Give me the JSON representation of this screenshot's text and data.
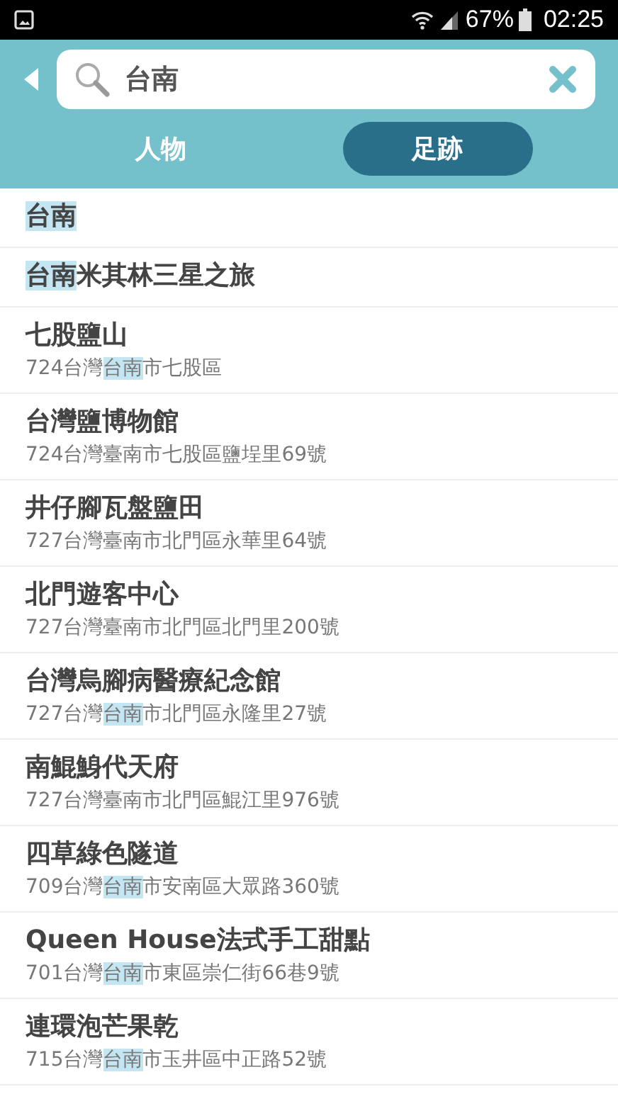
{
  "status_bar": {
    "battery": "67%",
    "time": "02:25"
  },
  "search": {
    "value": "台南"
  },
  "tabs": [
    {
      "label": "人物",
      "selected": false
    },
    {
      "label": "足跡",
      "selected": true
    }
  ],
  "results": [
    {
      "name": [
        {
          "text": "台南",
          "highlighted": true
        }
      ]
    },
    {
      "name": [
        {
          "text": "台南",
          "highlighted": true
        },
        {
          "text": "米其林三星之旅",
          "highlighted": false
        }
      ]
    },
    {
      "name": [
        {
          "text": "七股鹽山",
          "highlighted": false
        }
      ],
      "address": [
        {
          "text": "724台灣",
          "highlighted": false
        },
        {
          "text": "台南",
          "highlighted": true
        },
        {
          "text": "市七股區",
          "highlighted": false
        }
      ]
    },
    {
      "name": [
        {
          "text": "台灣鹽博物館",
          "highlighted": false
        }
      ],
      "address": [
        {
          "text": "724台灣臺南市七股區鹽埕里69號",
          "highlighted": false
        }
      ]
    },
    {
      "name": [
        {
          "text": "井仔腳瓦盤鹽田",
          "highlighted": false
        }
      ],
      "address": [
        {
          "text": "727台灣臺南市北門區永華里64號",
          "highlighted": false
        }
      ]
    },
    {
      "name": [
        {
          "text": "北門遊客中心",
          "highlighted": false
        }
      ],
      "address": [
        {
          "text": "727台灣臺南市北門區北門里200號",
          "highlighted": false
        }
      ]
    },
    {
      "name": [
        {
          "text": "台灣烏腳病醫療紀念館",
          "highlighted": false
        }
      ],
      "address": [
        {
          "text": "727台灣",
          "highlighted": false
        },
        {
          "text": "台南",
          "highlighted": true
        },
        {
          "text": "市北門區永隆里27號",
          "highlighted": false
        }
      ]
    },
    {
      "name": [
        {
          "text": "南鯤鯓代天府",
          "highlighted": false
        }
      ],
      "address": [
        {
          "text": "727台灣臺南市北門區鯤江里976號",
          "highlighted": false
        }
      ]
    },
    {
      "name": [
        {
          "text": "四草綠色隧道",
          "highlighted": false
        }
      ],
      "address": [
        {
          "text": "709台灣",
          "highlighted": false
        },
        {
          "text": "台南",
          "highlighted": true
        },
        {
          "text": "市安南區大眾路360號",
          "highlighted": false
        }
      ]
    },
    {
      "name": [
        {
          "text": "Queen House法式手工甜點",
          "highlighted": false
        }
      ],
      "address": [
        {
          "text": "701台灣",
          "highlighted": false
        },
        {
          "text": "台南",
          "highlighted": true
        },
        {
          "text": "市東區崇仁街66巷9號",
          "highlighted": false
        }
      ]
    },
    {
      "name": [
        {
          "text": "連環泡芒果乾",
          "highlighted": false
        }
      ],
      "address": [
        {
          "text": "715台灣",
          "highlighted": false
        },
        {
          "text": "台南",
          "highlighted": true
        },
        {
          "text": "市玉井區中正路52號",
          "highlighted": false
        }
      ]
    }
  ]
}
